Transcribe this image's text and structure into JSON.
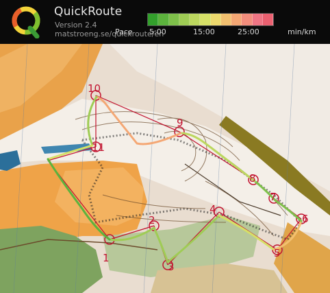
{
  "app": {
    "name": "QuickRoute",
    "version": "Version 2.4",
    "url": "matstroeng.se/quickroute/en"
  },
  "pace": {
    "label": "Pace",
    "ticks": [
      "5:00",
      "15:00",
      "25:00"
    ],
    "unit": "min/km",
    "colors": [
      "#33a02c",
      "#5cb33d",
      "#7ec04a",
      "#9fcc55",
      "#bcd75f",
      "#d6e067",
      "#ecd96d",
      "#f2c06f",
      "#f4a774",
      "#f28d7c",
      "#ef7584",
      "#ea6070"
    ]
  },
  "map": {
    "controls": [
      "1",
      "2",
      "3",
      "4",
      "5",
      "6",
      "7",
      "8",
      "9",
      "10",
      "11"
    ],
    "colors": {
      "control": "#c1122f",
      "forest_open": "#f2a24a",
      "rough_open": "#f6cf8e",
      "paper": "#efe6dc",
      "green": "#9cc080",
      "olive": "#9a8a2a",
      "water": "#2b6f9a"
    }
  }
}
